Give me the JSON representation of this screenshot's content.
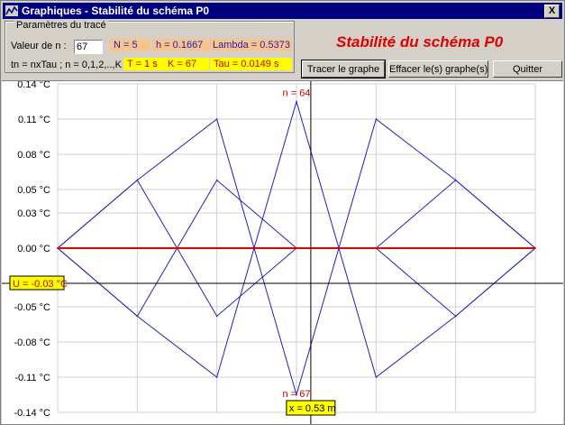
{
  "window": {
    "title": "Graphiques - Stabilité du schéma P0",
    "close_label": "X"
  },
  "params": {
    "legend": "Paramètres du tracé",
    "n_label": "Valeur de n :",
    "n_value": "67",
    "N": "N = 5",
    "h": "h = 0.1667",
    "lambda": "Lambda = 0.5373",
    "tn_label": "tn = nxTau ; n = 0,1,2,..,K",
    "T": "T = 1 s",
    "K": "K = 67",
    "tau": "Tau = 0.0149 s"
  },
  "heading": "Stabilité du schéma P0",
  "buttons": {
    "trace": "Tracer le graphe",
    "clear": "Effacer le(s) graphe(s)",
    "quit": "Quitter"
  },
  "colors": {
    "accent_red": "#e00000",
    "curve_blue": "#2020c0",
    "title_blue": "#000080",
    "readout_yellow": "#ffff00"
  },
  "chart_data": {
    "type": "line",
    "y_ticks": [
      "0.14 °C",
      "0.11 °C",
      "0.08 °C",
      "0.05 °C",
      "0.03 °C",
      "0.00 °C",
      "-0.03 °C",
      "-0.05 °C",
      "-0.08 °C",
      "-0.11 °C",
      "-0.14 °C"
    ],
    "y_tick_values": [
      0.14,
      0.11,
      0.08,
      0.05,
      0.03,
      0.0,
      -0.03,
      -0.05,
      -0.08,
      -0.11,
      -0.14
    ],
    "ylim": [
      -0.14,
      0.14
    ],
    "xlim": [
      0,
      1
    ],
    "grid": true,
    "series": [
      {
        "color": "#2020c0",
        "x": [
          0,
          0.1667,
          0.3333,
          0.5,
          0.6667,
          0.8333,
          1
        ],
        "y": [
          0,
          0.058,
          -0.058,
          0,
          0,
          -0.058,
          0
        ]
      },
      {
        "color": "#2020c0",
        "x": [
          0,
          0.1667,
          0.3333,
          0.5,
          0.6667,
          0.8333,
          1
        ],
        "y": [
          0,
          -0.058,
          0.058,
          0,
          0,
          0.058,
          0
        ]
      },
      {
        "color": "#2020c0",
        "x": [
          0,
          0.1667,
          0.3333,
          0.5,
          0.6667,
          0.8333,
          1
        ],
        "y": [
          0,
          0.058,
          0.11,
          -0.125,
          0.11,
          0.058,
          0
        ]
      },
      {
        "color": "#2020c0",
        "x": [
          0,
          0.1667,
          0.3333,
          0.5,
          0.6667,
          0.8333,
          1
        ],
        "y": [
          0,
          -0.058,
          -0.11,
          0.125,
          -0.11,
          -0.058,
          0
        ]
      },
      {
        "color": "#e00000",
        "x": [
          0,
          1
        ],
        "y": [
          0,
          0
        ]
      }
    ],
    "annotations": {
      "top": "n = 64",
      "bottom": "n = 67"
    },
    "cursor": {
      "x": 0.53,
      "y": -0.03,
      "x_label": "x = 0.53 m",
      "y_label": "U = -0.03 °C"
    }
  }
}
